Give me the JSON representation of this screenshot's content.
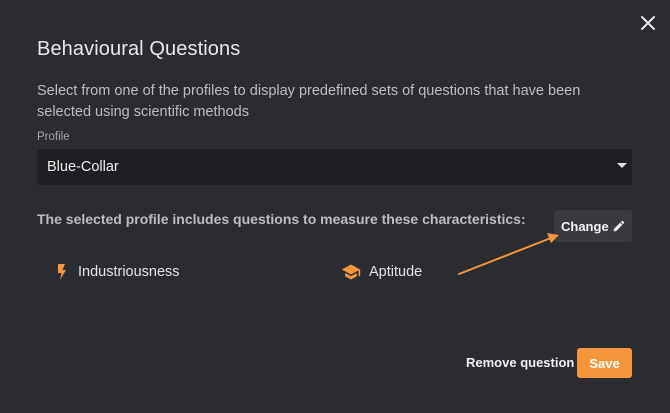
{
  "dialog": {
    "title": "Behavioural Questions",
    "description": "Select from one of the profiles to display predefined sets of questions that have been selected using scientific methods",
    "close_icon": "close-icon"
  },
  "profile": {
    "label": "Profile",
    "selected": "Blue-Collar"
  },
  "characteristics": {
    "heading": "The selected profile includes questions to measure these characteristics:",
    "change_label": "Change",
    "change_icon": "pencil-icon",
    "items": [
      {
        "label": "Industriousness",
        "icon": "lightning-bolt-icon"
      },
      {
        "label": "Aptitude",
        "icon": "graduation-cap-icon"
      }
    ]
  },
  "annotation": {
    "arrow_color": "#f5953c"
  },
  "footer": {
    "remove_label": "Remove question",
    "save_label": "Save"
  },
  "colors": {
    "background": "#2b2c31",
    "accent": "#f5953c",
    "select_bg": "#1e1f22",
    "button_bg": "#393a40"
  }
}
